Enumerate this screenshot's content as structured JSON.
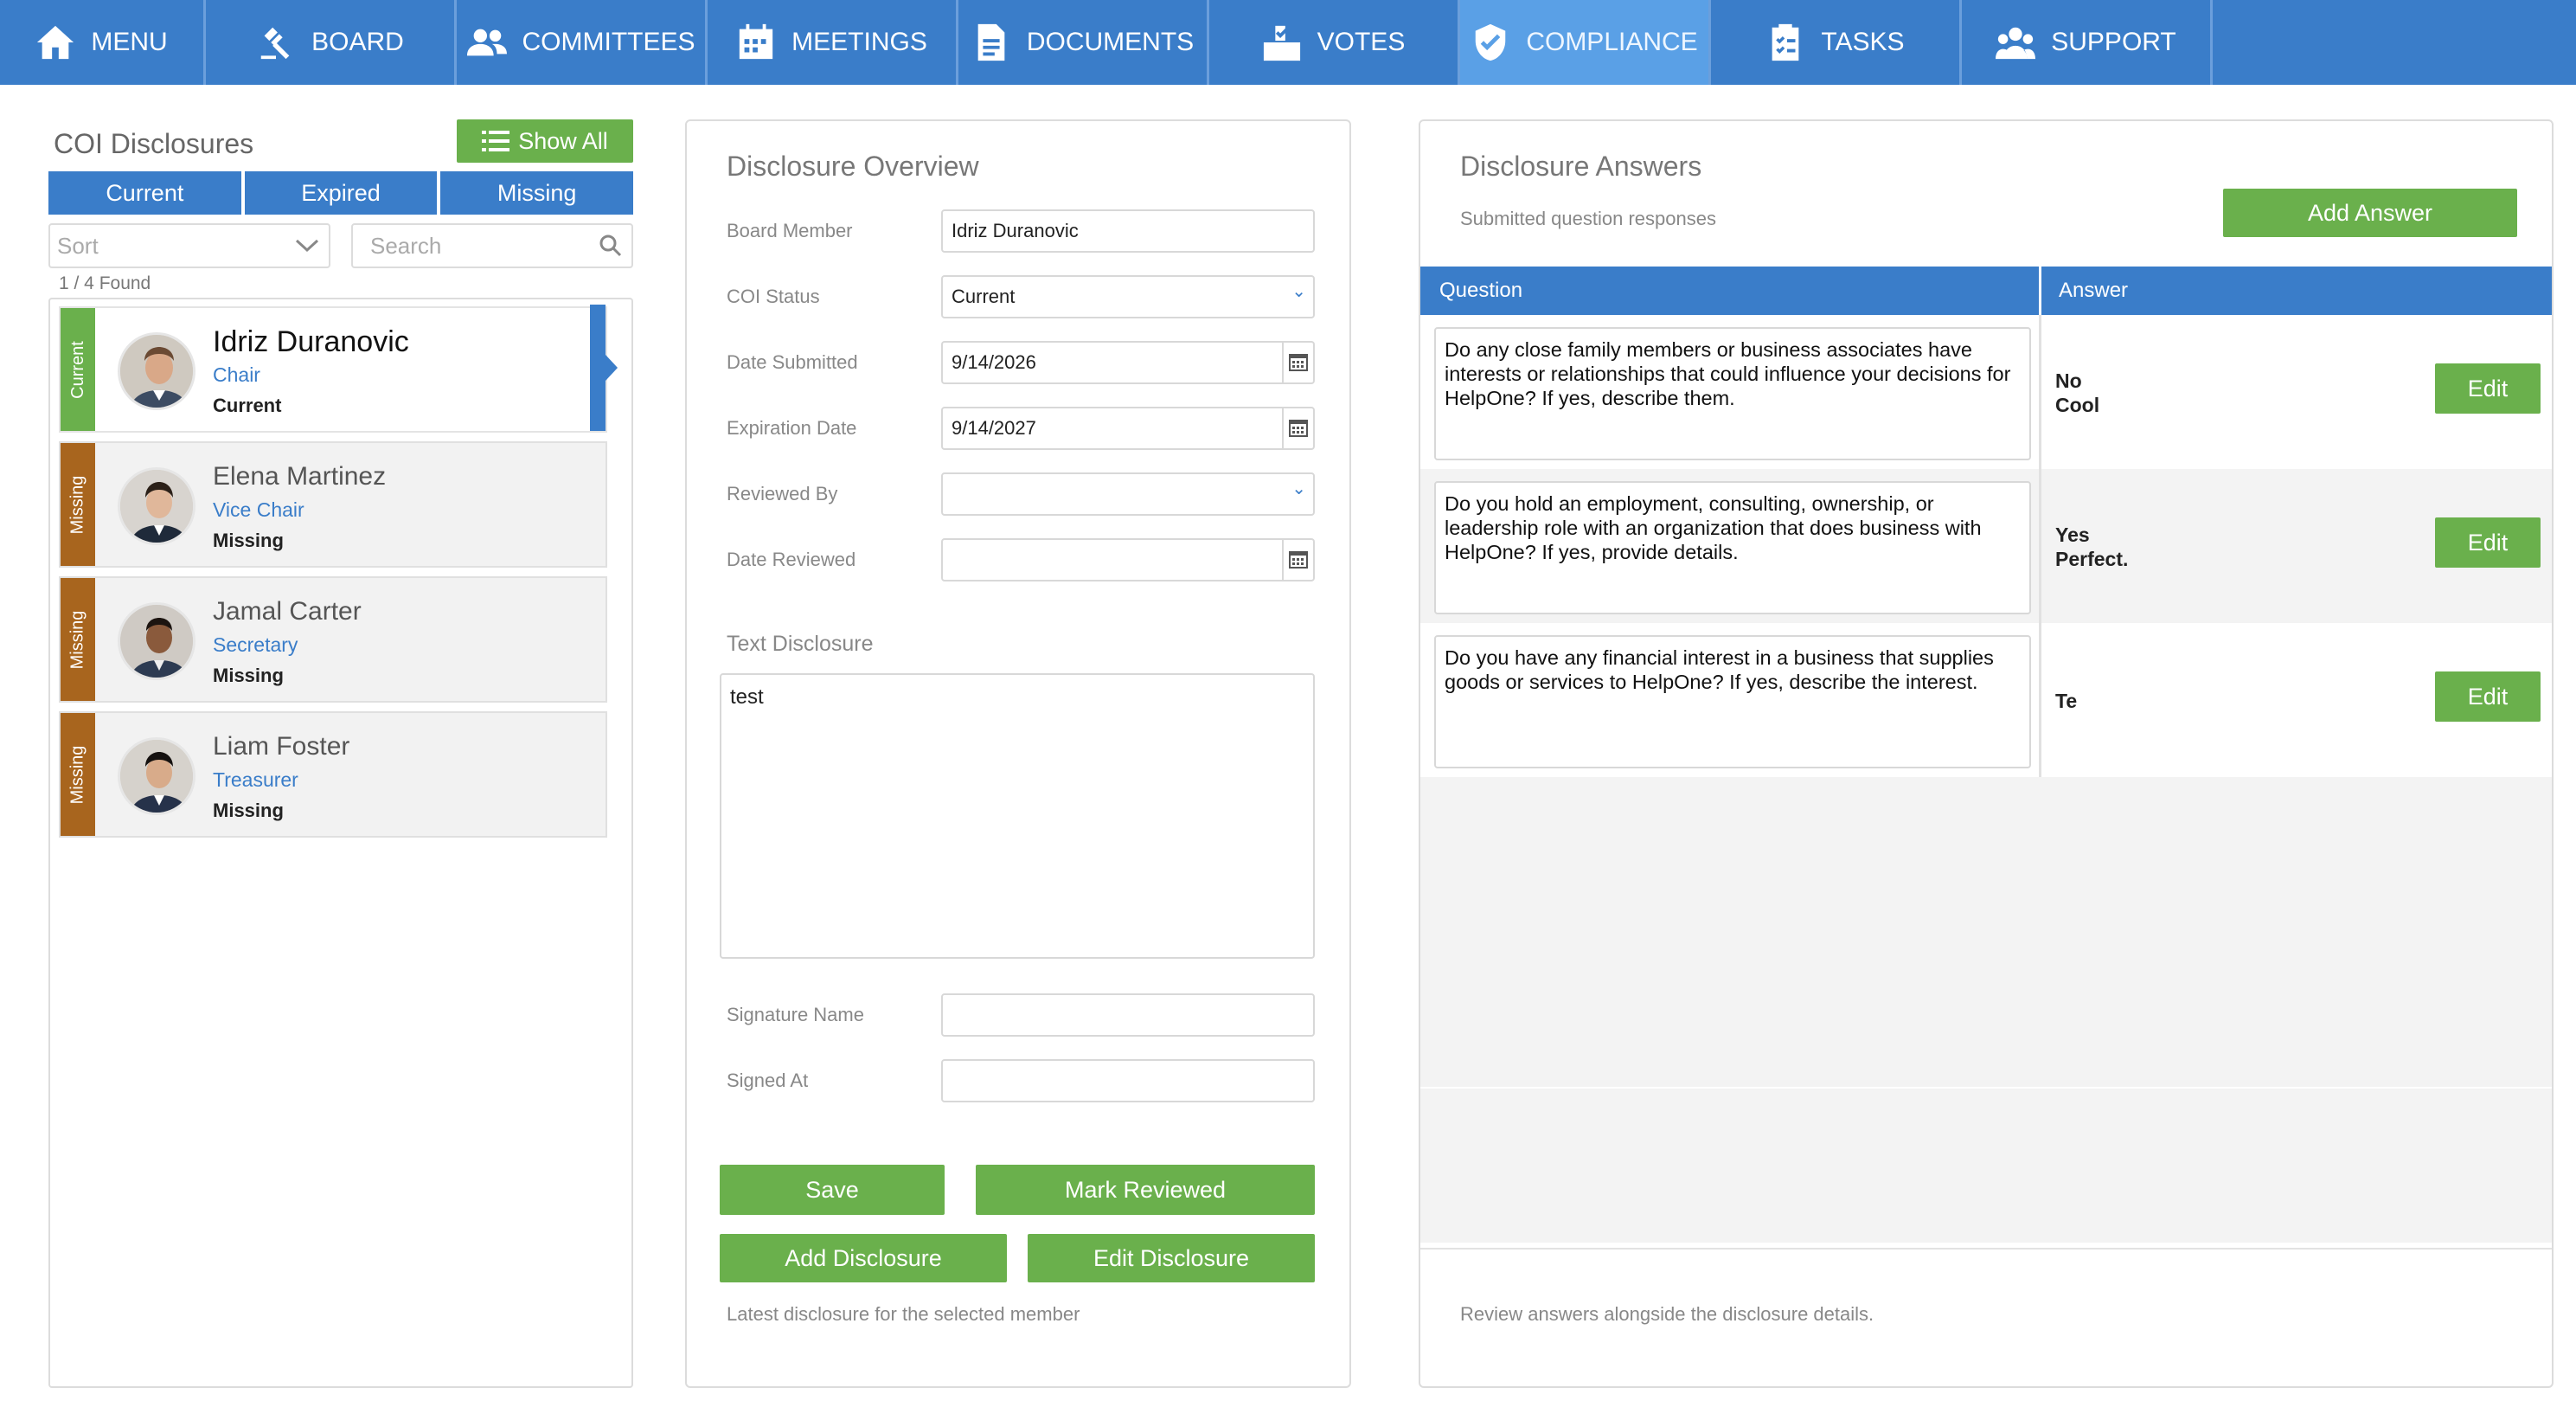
{
  "nav": {
    "items": [
      {
        "label": "MENU",
        "icon": "home-icon"
      },
      {
        "label": "BOARD",
        "icon": "gavel-icon"
      },
      {
        "label": "COMMITTEES",
        "icon": "people-icon"
      },
      {
        "label": "MEETINGS",
        "icon": "calendar-icon"
      },
      {
        "label": "DOCUMENTS",
        "icon": "document-icon"
      },
      {
        "label": "VOTES",
        "icon": "ballot-box-icon"
      },
      {
        "label": "COMPLIANCE",
        "icon": "shield-check-icon"
      },
      {
        "label": "TASKS",
        "icon": "clipboard-checklist-icon"
      },
      {
        "label": "SUPPORT",
        "icon": "support-group-icon"
      }
    ],
    "active": "COMPLIANCE",
    "bar_color": "#3a7dc9",
    "active_color": "#5aa0e6"
  },
  "left": {
    "title": "COI Disclosures",
    "show_all_label": "Show All",
    "tabs": [
      "Current",
      "Expired",
      "Missing"
    ],
    "sort_placeholder": "Sort",
    "search_placeholder": "Search",
    "found_text": "1 / 4 Found",
    "members": [
      {
        "name": "Idriz Duranovic",
        "role": "Chair",
        "status": "Current",
        "strip": "Current",
        "selected": true
      },
      {
        "name": "Elena Martinez",
        "role": "Vice Chair",
        "status": "Missing",
        "strip": "Missing",
        "selected": false
      },
      {
        "name": "Jamal Carter",
        "role": "Secretary",
        "status": "Missing",
        "strip": "Missing",
        "selected": false
      },
      {
        "name": "Liam Foster",
        "role": "Treasurer",
        "status": "Missing",
        "strip": "Missing",
        "selected": false
      }
    ]
  },
  "overview": {
    "title": "Disclosure Overview",
    "fields": {
      "board_member": {
        "label": "Board Member",
        "value": "Idriz Duranovic"
      },
      "coi_status": {
        "label": "COI Status",
        "value": "Current"
      },
      "date_submitted": {
        "label": "Date Submitted",
        "value": "9/14/2026"
      },
      "expiration_date": {
        "label": "Expiration Date",
        "value": "9/14/2027"
      },
      "reviewed_by": {
        "label": "Reviewed By",
        "value": ""
      },
      "date_reviewed": {
        "label": "Date Reviewed",
        "value": ""
      },
      "signature_name": {
        "label": "Signature Name",
        "value": ""
      },
      "signed_at": {
        "label": "Signed At",
        "value": ""
      }
    },
    "text_disclosure_label": "Text Disclosure",
    "text_disclosure_value": "test",
    "buttons": {
      "save": "Save",
      "mark_reviewed": "Mark Reviewed",
      "add_disclosure": "Add Disclosure",
      "edit_disclosure": "Edit Disclosure"
    },
    "footer": "Latest disclosure for the selected member"
  },
  "answers": {
    "title": "Disclosure Answers",
    "subtitle": "Submitted question responses",
    "add_answer_label": "Add Answer",
    "col_question": "Question",
    "col_answer": "Answer",
    "edit_label": "Edit",
    "rows": [
      {
        "question": "Do any close family members or business associates have interests or relationships that could influence your decisions for HelpOne? If yes, describe them.",
        "answer_line1": "No",
        "answer_line2": "Cool"
      },
      {
        "question": "Do you hold an employment, consulting, ownership, or leadership role with an organization that does business with HelpOne? If yes, provide details.",
        "answer_line1": "Yes",
        "answer_line2": "Perfect."
      },
      {
        "question": "Do you have any financial interest in a business that supplies goods or services to HelpOne? If yes, describe the interest.",
        "answer_line1": "Te",
        "answer_line2": ""
      }
    ],
    "footer": "Review answers alongside the disclosure details."
  },
  "colors": {
    "primary_blue": "#3a7dc9",
    "green": "#6ab04c",
    "missing_brown": "#a8651e"
  }
}
